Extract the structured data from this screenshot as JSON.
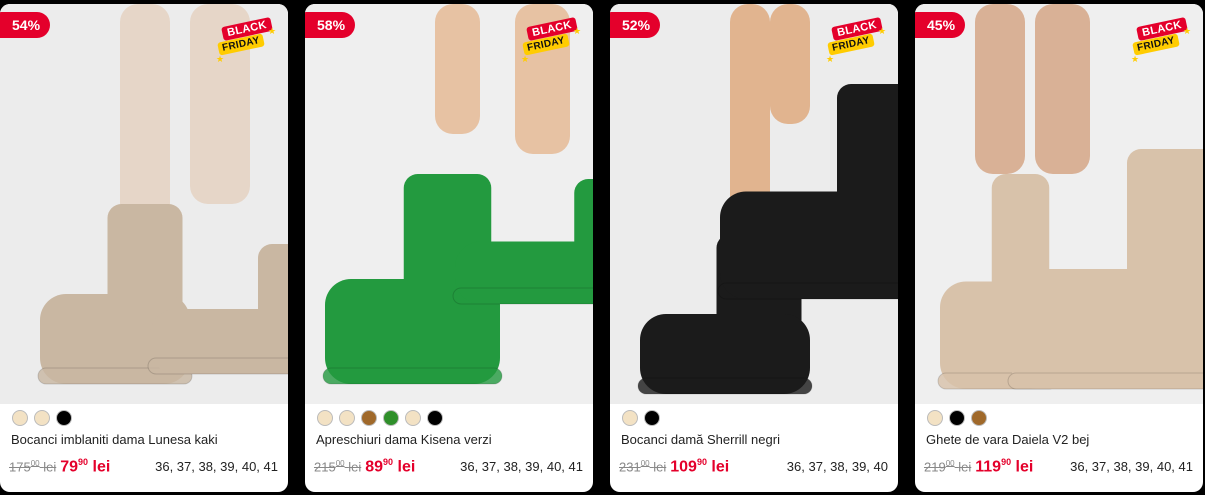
{
  "badge_text": {
    "line1": "BLACK",
    "line2": "FRIDAY"
  },
  "products": [
    {
      "discount": "54%",
      "title": "Bocanci imblaniti dama Lunesa kaki",
      "old_price_int": "175",
      "old_price_dec": "00",
      "old_price_unit": "lei",
      "new_price_int": "79",
      "new_price_dec": "90",
      "new_price_unit": "lei",
      "sizes": "36, 37, 38, 39, 40, 41",
      "swatches": [
        "#f3e2c4",
        "#f3e2c4",
        "#000000"
      ],
      "colors": {
        "leg": "#e6d6c8",
        "boot": "#c9b7a2",
        "bg": "#ececec"
      }
    },
    {
      "discount": "58%",
      "title": "Apreschiuri dama Kisena verzi",
      "old_price_int": "215",
      "old_price_dec": "00",
      "old_price_unit": "lei",
      "new_price_int": "89",
      "new_price_dec": "90",
      "new_price_unit": "lei",
      "sizes": "36, 37, 38, 39, 40, 41",
      "swatches": [
        "#f3e2c4",
        "#f3e2c4",
        "#a0692a",
        "#2f8f2a",
        "#f3e2c4",
        "#000000"
      ],
      "colors": {
        "leg": "#e7c2a3",
        "boot": "#239a3f",
        "bg": "#efefef"
      }
    },
    {
      "discount": "52%",
      "title": "Bocanci damă Sherrill negri",
      "old_price_int": "231",
      "old_price_dec": "00",
      "old_price_unit": "lei",
      "new_price_int": "109",
      "new_price_dec": "90",
      "new_price_unit": "lei",
      "sizes": "36, 37, 38, 39, 40",
      "swatches": [
        "#f3e2c4",
        "#000000"
      ],
      "colors": {
        "leg": "#e1b48f",
        "boot": "#1b1b1b",
        "bg": "#ececec"
      }
    },
    {
      "discount": "45%",
      "title": "Ghete de vara Daiela V2 bej",
      "old_price_int": "219",
      "old_price_dec": "00",
      "old_price_unit": "lei",
      "new_price_int": "119",
      "new_price_dec": "90",
      "new_price_unit": "lei",
      "sizes": "36, 37, 38, 39, 40, 41",
      "swatches": [
        "#f3e2c4",
        "#000000",
        "#a0692a"
      ],
      "colors": {
        "leg": "#d9b196",
        "boot": "#d8c2aa",
        "bg": "#efefef"
      }
    }
  ]
}
